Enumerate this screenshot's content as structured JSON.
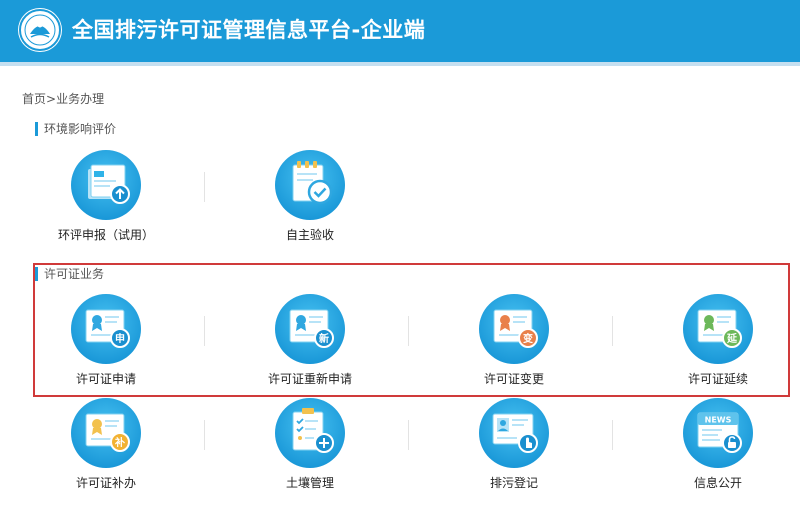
{
  "header": {
    "title": "全国排污许可证管理信息平台-企业端",
    "logo_icon": "environmental-protection-emblem"
  },
  "breadcrumb": {
    "home": "首页",
    "separator": ">",
    "current": "业务办理"
  },
  "sections": [
    {
      "title": "环境影响评价",
      "items": [
        {
          "label": "环评申报（试用）",
          "icon": "document-upload-icon"
        },
        {
          "label": "自主验收",
          "icon": "checklist-checkmark-icon"
        }
      ]
    },
    {
      "title": "许可证业务",
      "items": [
        {
          "label": "许可证申请",
          "icon": "certificate-apply-icon",
          "badge": "申"
        },
        {
          "label": "许可证重新申请",
          "icon": "certificate-reapply-icon",
          "badge": "新"
        },
        {
          "label": "许可证变更",
          "icon": "certificate-change-icon",
          "badge": "变"
        },
        {
          "label": "许可证延续",
          "icon": "certificate-extend-icon",
          "badge": "延"
        }
      ]
    },
    {
      "title": "",
      "items": [
        {
          "label": "许可证补办",
          "icon": "certificate-reissue-icon",
          "badge": "补"
        },
        {
          "label": "土壤管理",
          "icon": "soil-management-icon"
        },
        {
          "label": "排污登记",
          "icon": "discharge-registration-icon"
        },
        {
          "label": "信息公开",
          "icon": "news-disclosure-icon",
          "badge": "NEWS"
        }
      ]
    }
  ],
  "colors": {
    "header_bg": "#1b9ad8",
    "accent": "#1b9ad8",
    "highlight_border": "#d03a3a",
    "badge_orange": "#e9804a",
    "badge_green": "#6cb85a"
  }
}
